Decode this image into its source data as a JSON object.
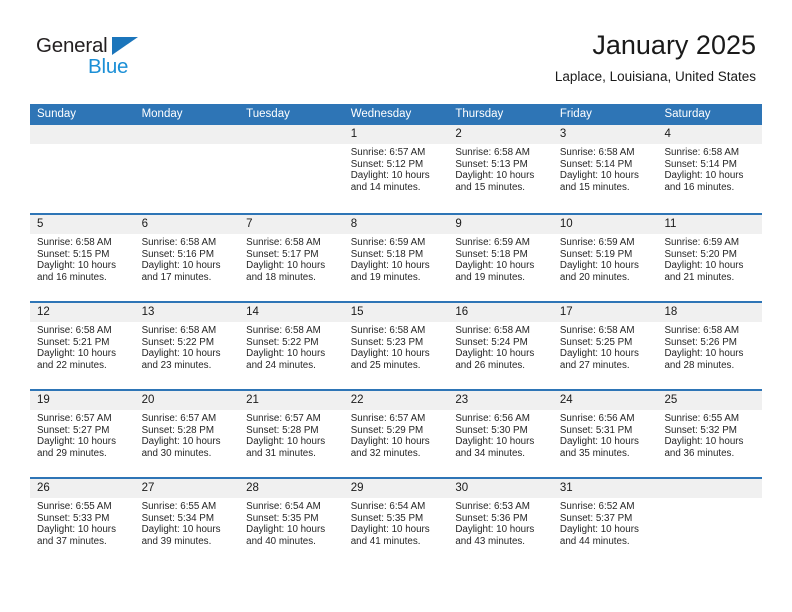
{
  "brand": {
    "name_top": "General",
    "name_bottom": "Blue",
    "accent_color": "#1b75bb",
    "blue_text_color": "#1b8fd6"
  },
  "header": {
    "month_title": "January 2025",
    "location": "Laplace, Louisiana, United States"
  },
  "theme": {
    "header_blue": "#2e75b6",
    "day_band_gray": "#f0f0f0"
  },
  "weekdays": [
    "Sunday",
    "Monday",
    "Tuesday",
    "Wednesday",
    "Thursday",
    "Friday",
    "Saturday"
  ],
  "labels": {
    "sunrise_prefix": "Sunrise:",
    "sunset_prefix": "Sunset:",
    "daylight_prefix": "Daylight:"
  },
  "weeks": [
    [
      {
        "day": "",
        "empty": true,
        "sunrise": "",
        "sunset": "",
        "daylight_line1": "",
        "daylight_line2": ""
      },
      {
        "day": "",
        "empty": true,
        "sunrise": "",
        "sunset": "",
        "daylight_line1": "",
        "daylight_line2": ""
      },
      {
        "day": "",
        "empty": true,
        "sunrise": "",
        "sunset": "",
        "daylight_line1": "",
        "daylight_line2": ""
      },
      {
        "day": "1",
        "empty": false,
        "sunrise": "Sunrise: 6:57 AM",
        "sunset": "Sunset: 5:12 PM",
        "daylight_line1": "Daylight: 10 hours",
        "daylight_line2": "and 14 minutes."
      },
      {
        "day": "2",
        "empty": false,
        "sunrise": "Sunrise: 6:58 AM",
        "sunset": "Sunset: 5:13 PM",
        "daylight_line1": "Daylight: 10 hours",
        "daylight_line2": "and 15 minutes."
      },
      {
        "day": "3",
        "empty": false,
        "sunrise": "Sunrise: 6:58 AM",
        "sunset": "Sunset: 5:14 PM",
        "daylight_line1": "Daylight: 10 hours",
        "daylight_line2": "and 15 minutes."
      },
      {
        "day": "4",
        "empty": false,
        "sunrise": "Sunrise: 6:58 AM",
        "sunset": "Sunset: 5:14 PM",
        "daylight_line1": "Daylight: 10 hours",
        "daylight_line2": "and 16 minutes."
      }
    ],
    [
      {
        "day": "5",
        "empty": false,
        "sunrise": "Sunrise: 6:58 AM",
        "sunset": "Sunset: 5:15 PM",
        "daylight_line1": "Daylight: 10 hours",
        "daylight_line2": "and 16 minutes."
      },
      {
        "day": "6",
        "empty": false,
        "sunrise": "Sunrise: 6:58 AM",
        "sunset": "Sunset: 5:16 PM",
        "daylight_line1": "Daylight: 10 hours",
        "daylight_line2": "and 17 minutes."
      },
      {
        "day": "7",
        "empty": false,
        "sunrise": "Sunrise: 6:58 AM",
        "sunset": "Sunset: 5:17 PM",
        "daylight_line1": "Daylight: 10 hours",
        "daylight_line2": "and 18 minutes."
      },
      {
        "day": "8",
        "empty": false,
        "sunrise": "Sunrise: 6:59 AM",
        "sunset": "Sunset: 5:18 PM",
        "daylight_line1": "Daylight: 10 hours",
        "daylight_line2": "and 19 minutes."
      },
      {
        "day": "9",
        "empty": false,
        "sunrise": "Sunrise: 6:59 AM",
        "sunset": "Sunset: 5:18 PM",
        "daylight_line1": "Daylight: 10 hours",
        "daylight_line2": "and 19 minutes."
      },
      {
        "day": "10",
        "empty": false,
        "sunrise": "Sunrise: 6:59 AM",
        "sunset": "Sunset: 5:19 PM",
        "daylight_line1": "Daylight: 10 hours",
        "daylight_line2": "and 20 minutes."
      },
      {
        "day": "11",
        "empty": false,
        "sunrise": "Sunrise: 6:59 AM",
        "sunset": "Sunset: 5:20 PM",
        "daylight_line1": "Daylight: 10 hours",
        "daylight_line2": "and 21 minutes."
      }
    ],
    [
      {
        "day": "12",
        "empty": false,
        "sunrise": "Sunrise: 6:58 AM",
        "sunset": "Sunset: 5:21 PM",
        "daylight_line1": "Daylight: 10 hours",
        "daylight_line2": "and 22 minutes."
      },
      {
        "day": "13",
        "empty": false,
        "sunrise": "Sunrise: 6:58 AM",
        "sunset": "Sunset: 5:22 PM",
        "daylight_line1": "Daylight: 10 hours",
        "daylight_line2": "and 23 minutes."
      },
      {
        "day": "14",
        "empty": false,
        "sunrise": "Sunrise: 6:58 AM",
        "sunset": "Sunset: 5:22 PM",
        "daylight_line1": "Daylight: 10 hours",
        "daylight_line2": "and 24 minutes."
      },
      {
        "day": "15",
        "empty": false,
        "sunrise": "Sunrise: 6:58 AM",
        "sunset": "Sunset: 5:23 PM",
        "daylight_line1": "Daylight: 10 hours",
        "daylight_line2": "and 25 minutes."
      },
      {
        "day": "16",
        "empty": false,
        "sunrise": "Sunrise: 6:58 AM",
        "sunset": "Sunset: 5:24 PM",
        "daylight_line1": "Daylight: 10 hours",
        "daylight_line2": "and 26 minutes."
      },
      {
        "day": "17",
        "empty": false,
        "sunrise": "Sunrise: 6:58 AM",
        "sunset": "Sunset: 5:25 PM",
        "daylight_line1": "Daylight: 10 hours",
        "daylight_line2": "and 27 minutes."
      },
      {
        "day": "18",
        "empty": false,
        "sunrise": "Sunrise: 6:58 AM",
        "sunset": "Sunset: 5:26 PM",
        "daylight_line1": "Daylight: 10 hours",
        "daylight_line2": "and 28 minutes."
      }
    ],
    [
      {
        "day": "19",
        "empty": false,
        "sunrise": "Sunrise: 6:57 AM",
        "sunset": "Sunset: 5:27 PM",
        "daylight_line1": "Daylight: 10 hours",
        "daylight_line2": "and 29 minutes."
      },
      {
        "day": "20",
        "empty": false,
        "sunrise": "Sunrise: 6:57 AM",
        "sunset": "Sunset: 5:28 PM",
        "daylight_line1": "Daylight: 10 hours",
        "daylight_line2": "and 30 minutes."
      },
      {
        "day": "21",
        "empty": false,
        "sunrise": "Sunrise: 6:57 AM",
        "sunset": "Sunset: 5:28 PM",
        "daylight_line1": "Daylight: 10 hours",
        "daylight_line2": "and 31 minutes."
      },
      {
        "day": "22",
        "empty": false,
        "sunrise": "Sunrise: 6:57 AM",
        "sunset": "Sunset: 5:29 PM",
        "daylight_line1": "Daylight: 10 hours",
        "daylight_line2": "and 32 minutes."
      },
      {
        "day": "23",
        "empty": false,
        "sunrise": "Sunrise: 6:56 AM",
        "sunset": "Sunset: 5:30 PM",
        "daylight_line1": "Daylight: 10 hours",
        "daylight_line2": "and 34 minutes."
      },
      {
        "day": "24",
        "empty": false,
        "sunrise": "Sunrise: 6:56 AM",
        "sunset": "Sunset: 5:31 PM",
        "daylight_line1": "Daylight: 10 hours",
        "daylight_line2": "and 35 minutes."
      },
      {
        "day": "25",
        "empty": false,
        "sunrise": "Sunrise: 6:55 AM",
        "sunset": "Sunset: 5:32 PM",
        "daylight_line1": "Daylight: 10 hours",
        "daylight_line2": "and 36 minutes."
      }
    ],
    [
      {
        "day": "26",
        "empty": false,
        "sunrise": "Sunrise: 6:55 AM",
        "sunset": "Sunset: 5:33 PM",
        "daylight_line1": "Daylight: 10 hours",
        "daylight_line2": "and 37 minutes."
      },
      {
        "day": "27",
        "empty": false,
        "sunrise": "Sunrise: 6:55 AM",
        "sunset": "Sunset: 5:34 PM",
        "daylight_line1": "Daylight: 10 hours",
        "daylight_line2": "and 39 minutes."
      },
      {
        "day": "28",
        "empty": false,
        "sunrise": "Sunrise: 6:54 AM",
        "sunset": "Sunset: 5:35 PM",
        "daylight_line1": "Daylight: 10 hours",
        "daylight_line2": "and 40 minutes."
      },
      {
        "day": "29",
        "empty": false,
        "sunrise": "Sunrise: 6:54 AM",
        "sunset": "Sunset: 5:35 PM",
        "daylight_line1": "Daylight: 10 hours",
        "daylight_line2": "and 41 minutes."
      },
      {
        "day": "30",
        "empty": false,
        "sunrise": "Sunrise: 6:53 AM",
        "sunset": "Sunset: 5:36 PM",
        "daylight_line1": "Daylight: 10 hours",
        "daylight_line2": "and 43 minutes."
      },
      {
        "day": "31",
        "empty": false,
        "sunrise": "Sunrise: 6:52 AM",
        "sunset": "Sunset: 5:37 PM",
        "daylight_line1": "Daylight: 10 hours",
        "daylight_line2": "and 44 minutes."
      },
      {
        "day": "",
        "empty": true,
        "sunrise": "",
        "sunset": "",
        "daylight_line1": "",
        "daylight_line2": ""
      }
    ]
  ]
}
